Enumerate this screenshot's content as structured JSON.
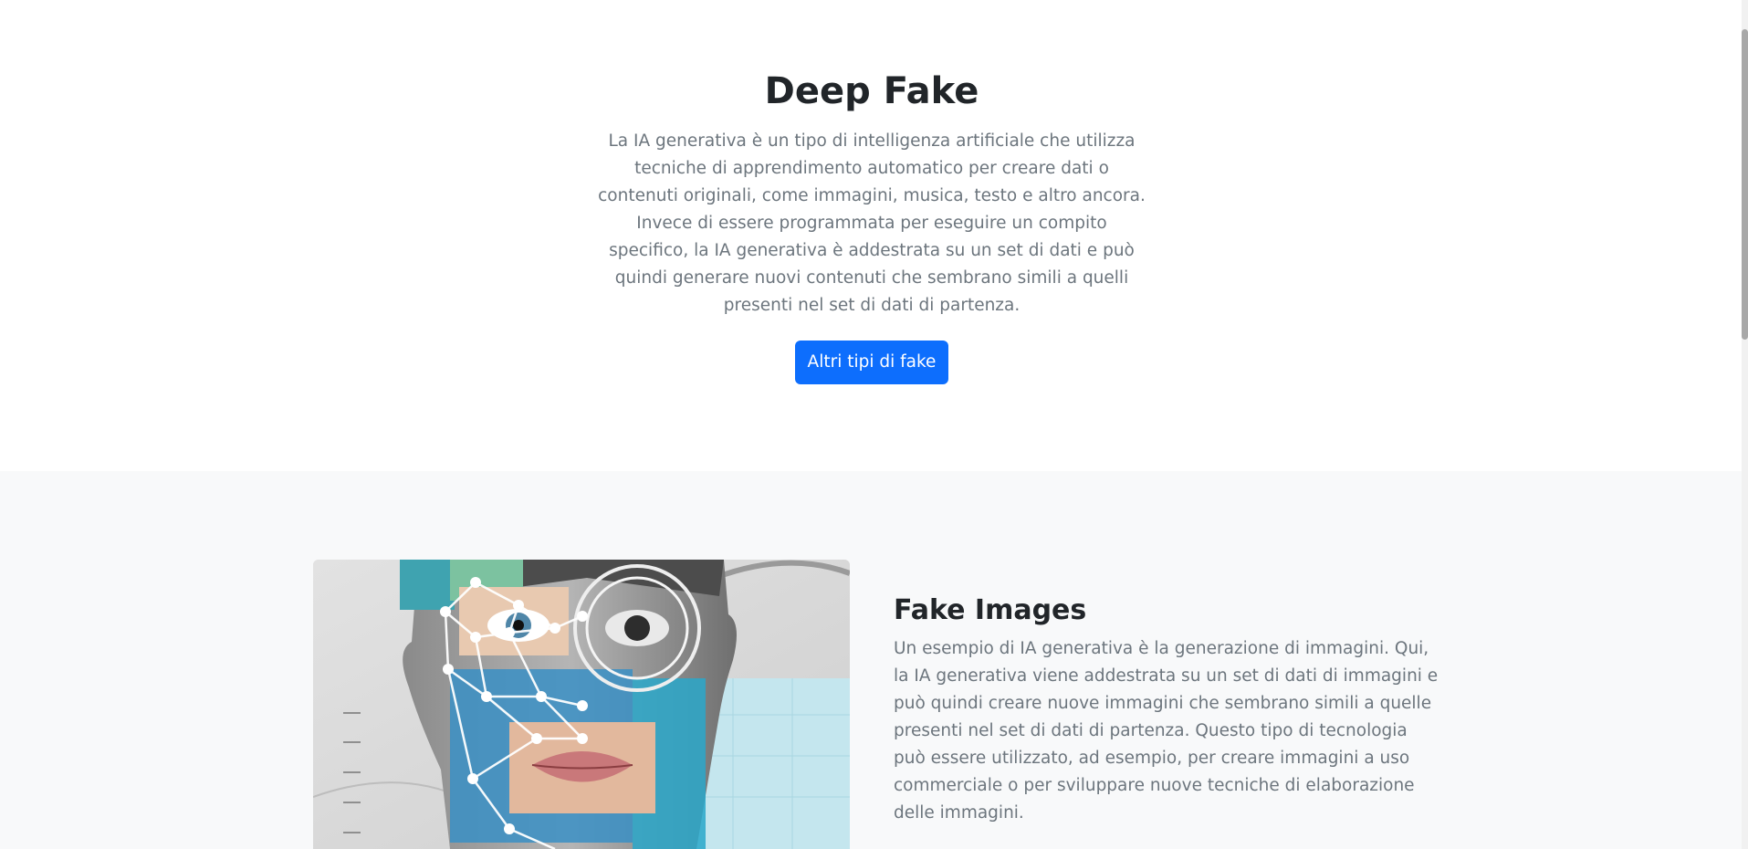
{
  "hero": {
    "title": "Deep Fake",
    "text": "La IA generativa è un tipo di intelligenza artificiale che utilizza tecniche di apprendimento automatico per creare dati o contenuti originali, come immagini, musica, testo e altro ancora. Invece di essere programmata per eseguire un compito specifico, la IA generativa è addestrata su un set di dati e può quindi generare nuovi contenuti che sembrano simili a quelli presenti nel set di dati di partenza.",
    "button_label": "Altri tipi di fake"
  },
  "feature": {
    "title": "Fake Images",
    "text": "Un esempio di IA generativa è la generazione di immagini. Qui, la IA generativa viene addestrata su un set di dati di immagini e può quindi creare nuove immagini che sembrano simili a quelle presenti nel set di dati di partenza. Questo tipo di tecnologia può essere utilizzato, ad esempio, per creare immagini a uso commerciale o per sviluppare nuove tecniche di elaborazione delle immagini."
  },
  "colors": {
    "primary": "#0d6efd",
    "heading": "#212529",
    "muted_text": "#6c757d",
    "section_bg": "#f8f9fa"
  }
}
